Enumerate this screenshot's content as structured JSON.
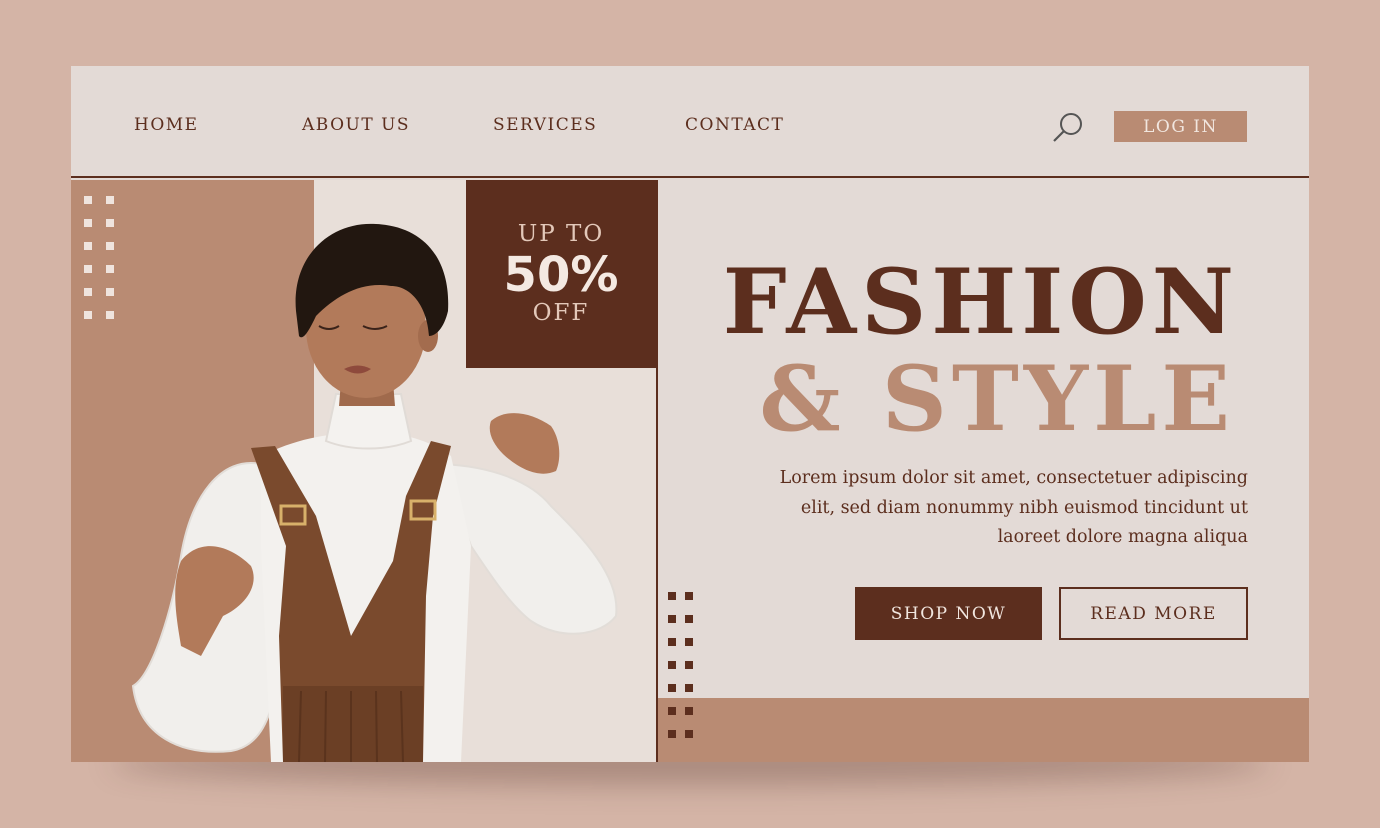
{
  "nav": {
    "links": [
      "HOME",
      "ABOUT US",
      "SERVICES",
      "CONTACT"
    ],
    "search_icon": "search-icon",
    "login_label": "LOG IN"
  },
  "promo": {
    "up_to": "UP TO",
    "percent": "50%",
    "off": "OFF"
  },
  "hero": {
    "title_line1": "FASHION",
    "title_line2": "& STYLE",
    "description_lines": [
      "Lorem ipsum dolor sit amet, consectetuer adipiscing",
      "elit, sed diam nonummy nibh euismod tincidunt ut",
      "laoreet dolore magna aliqua"
    ],
    "shop_label": "SHOP NOW",
    "read_label": "READ MORE"
  },
  "colors": {
    "dark_brown": "#5c2e1e",
    "tan": "#b98b73",
    "cream": "#e3dad6",
    "backdrop": "#d4b4a6"
  }
}
